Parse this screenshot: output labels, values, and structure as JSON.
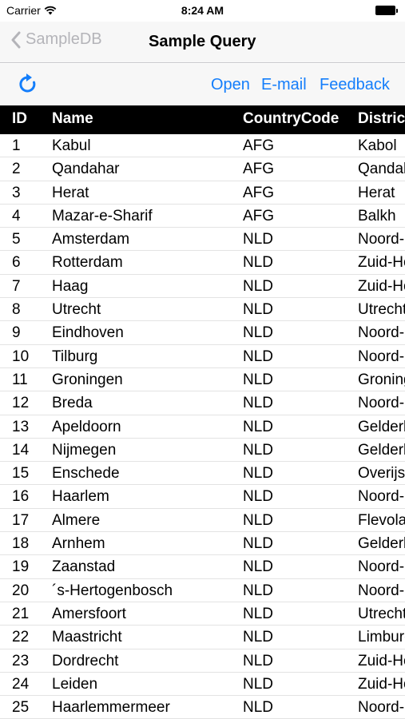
{
  "status_bar": {
    "carrier": "Carrier",
    "time": "8:24 AM"
  },
  "nav": {
    "back_label": "SampleDB",
    "title": "Sample Query"
  },
  "toolbar": {
    "refresh_icon": "refresh-icon",
    "open_label": "Open",
    "email_label": "E-mail",
    "feedback_label": "Feedback"
  },
  "colors": {
    "accent": "#147efb",
    "header_bg": "#000000",
    "back_text": "#b4b4b9"
  },
  "table": {
    "columns": [
      "ID",
      "Name",
      "CountryCode",
      "District"
    ],
    "rows": [
      [
        "1",
        "Kabul",
        "AFG",
        "Kabol"
      ],
      [
        "2",
        "Qandahar",
        "AFG",
        "Qandahar"
      ],
      [
        "3",
        "Herat",
        "AFG",
        "Herat"
      ],
      [
        "4",
        "Mazar-e-Sharif",
        "AFG",
        "Balkh"
      ],
      [
        "5",
        "Amsterdam",
        "NLD",
        "Noord-Holland"
      ],
      [
        "6",
        "Rotterdam",
        "NLD",
        "Zuid-Holland"
      ],
      [
        "7",
        "Haag",
        "NLD",
        "Zuid-Holland"
      ],
      [
        "8",
        "Utrecht",
        "NLD",
        "Utrecht"
      ],
      [
        "9",
        "Eindhoven",
        "NLD",
        "Noord-Brabant"
      ],
      [
        "10",
        "Tilburg",
        "NLD",
        "Noord-Brabant"
      ],
      [
        "11",
        "Groningen",
        "NLD",
        "Groningen"
      ],
      [
        "12",
        "Breda",
        "NLD",
        "Noord-Brabant"
      ],
      [
        "13",
        "Apeldoorn",
        "NLD",
        "Gelderland"
      ],
      [
        "14",
        "Nijmegen",
        "NLD",
        "Gelderland"
      ],
      [
        "15",
        "Enschede",
        "NLD",
        "Overijssel"
      ],
      [
        "16",
        "Haarlem",
        "NLD",
        "Noord-Holland"
      ],
      [
        "17",
        "Almere",
        "NLD",
        "Flevoland"
      ],
      [
        "18",
        "Arnhem",
        "NLD",
        "Gelderland"
      ],
      [
        "19",
        "Zaanstad",
        "NLD",
        "Noord-Holland"
      ],
      [
        "20",
        "´s-Hertogenbosch",
        "NLD",
        "Noord-Brabant"
      ],
      [
        "21",
        "Amersfoort",
        "NLD",
        "Utrecht"
      ],
      [
        "22",
        "Maastricht",
        "NLD",
        "Limburg"
      ],
      [
        "23",
        "Dordrecht",
        "NLD",
        "Zuid-Holland"
      ],
      [
        "24",
        "Leiden",
        "NLD",
        "Zuid-Holland"
      ],
      [
        "25",
        "Haarlemmermeer",
        "NLD",
        "Noord-Holland"
      ]
    ]
  }
}
